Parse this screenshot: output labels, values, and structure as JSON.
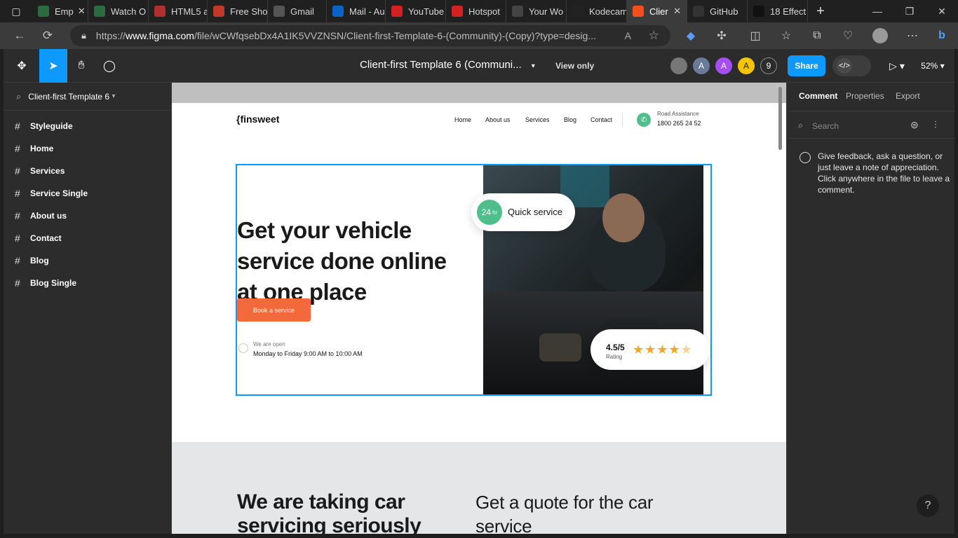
{
  "browser": {
    "tabs": [
      {
        "label": "Emp",
        "color": "#2b6b3f"
      },
      {
        "label": "Watch O",
        "color": "#2b6b3f"
      },
      {
        "label": "HTML5 a",
        "color": "#b03030"
      },
      {
        "label": "Free Sho",
        "color": "#c0392b"
      },
      {
        "label": "Gmail",
        "color": "#555555"
      },
      {
        "label": "Mail - Au",
        "color": "#0a64c8"
      },
      {
        "label": "YouTube",
        "color": "#d32020"
      },
      {
        "label": "Hotspot",
        "color": "#d32020"
      },
      {
        "label": "Your Wo",
        "color": "#444444"
      },
      {
        "label": "Kodecam",
        "color": "#222222"
      },
      {
        "label": "Clier",
        "color": "#f24e1e"
      },
      {
        "label": "GitHub",
        "color": "#333333"
      },
      {
        "label": "18 Effect",
        "color": "#111111"
      }
    ],
    "url_prefix": "https://",
    "url_host": "www.figma.com",
    "url_path": "/file/wCWfqsebDx4A1IK5VVZNSN/Client-first-Template-6-(Community)-(Copy)?type=desig..."
  },
  "figma": {
    "file_title": "Client-first Template 6 (Communi...",
    "view_only": "View only",
    "avatars": [
      "A",
      "A",
      "A",
      "9"
    ],
    "share": "Share",
    "zoom": "52%",
    "accent": "#0d99ff"
  },
  "left_panel": {
    "project": "Client-first Template 6",
    "pages": [
      "Styleguide",
      "Home",
      "Services",
      "Service Single",
      "About us",
      "Contact",
      "Blog",
      "Blog Single"
    ]
  },
  "site": {
    "logo": "{finsweet",
    "nav": [
      "Home",
      "About us",
      "Services",
      "Blog",
      "Contact"
    ],
    "road_label": "Road Assistance",
    "road_phone": "1800 265 24 52",
    "hero_title": "Get your vehicle service done online at one place",
    "cta": "Book a service",
    "open_label": "We are open",
    "open_hours": "Monday to Friday 9:00 AM to  10:00  AM",
    "quick_num": "24",
    "quick_unit": "hr",
    "quick_text": "Quick service",
    "rating_value": "4.5/5",
    "rating_label": "Rating",
    "rating_stars": 4.5,
    "section2_left": "We are taking car servicing seriously",
    "section2_right": "Get a quote for the car service",
    "accent_green": "#4ebf8a",
    "accent_orange": "#f26a3b"
  },
  "right_panel": {
    "tabs": [
      "Comment",
      "Properties",
      "Export"
    ],
    "search_placeholder": "Search",
    "hint": "Give feedback, ask a question, or just leave a note of appreciation. Click anywhere in the file to leave a comment.",
    "help": "?"
  }
}
